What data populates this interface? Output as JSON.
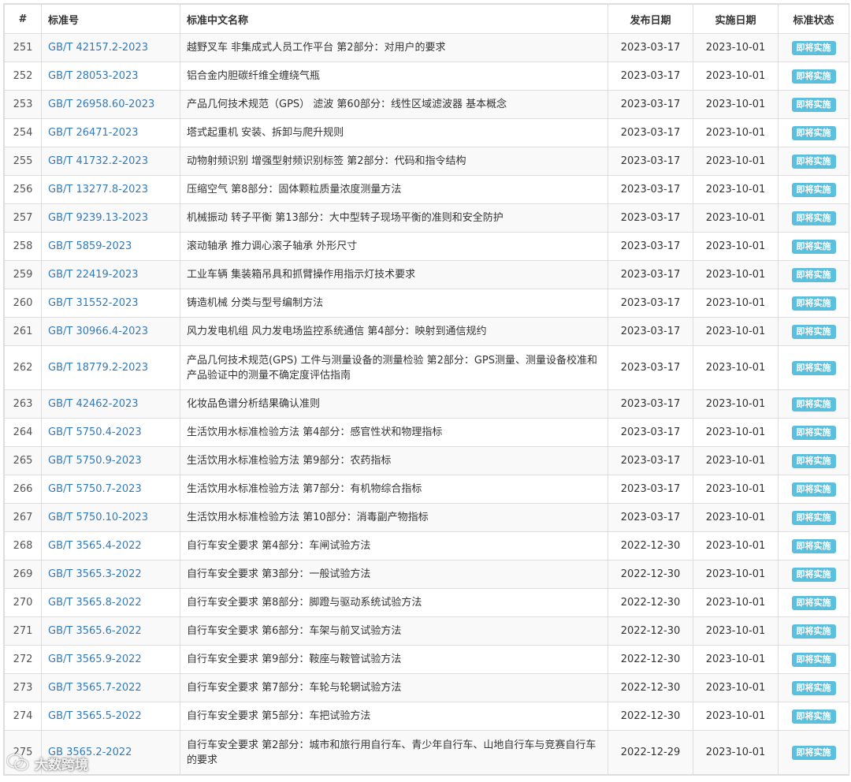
{
  "headers": {
    "num": "#",
    "code": "标准号",
    "name": "标准中文名称",
    "publish": "发布日期",
    "effective": "实施日期",
    "status": "标准状态"
  },
  "rows": [
    {
      "num": "251",
      "code": "GB/T 42157.2-2023",
      "name": "越野叉车 非集成式人员工作平台 第2部分：对用户的要求",
      "publish": "2023-03-17",
      "effective": "2023-10-01",
      "status": "即将实施"
    },
    {
      "num": "252",
      "code": "GB/T 28053-2023",
      "name": "铝合金内胆碳纤维全缠绕气瓶",
      "publish": "2023-03-17",
      "effective": "2023-10-01",
      "status": "即将实施"
    },
    {
      "num": "253",
      "code": "GB/T 26958.60-2023",
      "name": "产品几何技术规范（GPS） 滤波 第60部分：线性区域滤波器 基本概念",
      "publish": "2023-03-17",
      "effective": "2023-10-01",
      "status": "即将实施"
    },
    {
      "num": "254",
      "code": "GB/T 26471-2023",
      "name": "塔式起重机 安装、拆卸与爬升规则",
      "publish": "2023-03-17",
      "effective": "2023-10-01",
      "status": "即将实施"
    },
    {
      "num": "255",
      "code": "GB/T 41732.2-2023",
      "name": "动物射频识别 增强型射频识别标签 第2部分：代码和指令结构",
      "publish": "2023-03-17",
      "effective": "2023-10-01",
      "status": "即将实施"
    },
    {
      "num": "256",
      "code": "GB/T 13277.8-2023",
      "name": "压缩空气 第8部分：固体颗粒质量浓度测量方法",
      "publish": "2023-03-17",
      "effective": "2023-10-01",
      "status": "即将实施"
    },
    {
      "num": "257",
      "code": "GB/T 9239.13-2023",
      "name": "机械振动 转子平衡 第13部分：大中型转子现场平衡的准则和安全防护",
      "publish": "2023-03-17",
      "effective": "2023-10-01",
      "status": "即将实施"
    },
    {
      "num": "258",
      "code": "GB/T 5859-2023",
      "name": "滚动轴承 推力调心滚子轴承 外形尺寸",
      "publish": "2023-03-17",
      "effective": "2023-10-01",
      "status": "即将实施"
    },
    {
      "num": "259",
      "code": "GB/T 22419-2023",
      "name": "工业车辆 集装箱吊具和抓臂操作用指示灯技术要求",
      "publish": "2023-03-17",
      "effective": "2023-10-01",
      "status": "即将实施"
    },
    {
      "num": "260",
      "code": "GB/T 31552-2023",
      "name": "铸造机械 分类与型号编制方法",
      "publish": "2023-03-17",
      "effective": "2023-10-01",
      "status": "即将实施"
    },
    {
      "num": "261",
      "code": "GB/T 30966.4-2023",
      "name": "风力发电机组 风力发电场监控系统通信 第4部分：映射到通信规约",
      "publish": "2023-03-17",
      "effective": "2023-10-01",
      "status": "即将实施"
    },
    {
      "num": "262",
      "code": "GB/T 18779.2-2023",
      "name": "产品几何技术规范(GPS) 工件与测量设备的测量检验 第2部分：GPS测量、测量设备校准和产品验证中的测量不确定度评估指南",
      "publish": "2023-03-17",
      "effective": "2023-10-01",
      "status": "即将实施",
      "tall": true
    },
    {
      "num": "263",
      "code": "GB/T 42462-2023",
      "name": "化妆品色谱分析结果确认准则",
      "publish": "2023-03-17",
      "effective": "2023-10-01",
      "status": "即将实施"
    },
    {
      "num": "264",
      "code": "GB/T 5750.4-2023",
      "name": "生活饮用水标准检验方法 第4部分：感官性状和物理指标",
      "publish": "2023-03-17",
      "effective": "2023-10-01",
      "status": "即将实施"
    },
    {
      "num": "265",
      "code": "GB/T 5750.9-2023",
      "name": "生活饮用水标准检验方法 第9部分：农药指标",
      "publish": "2023-03-17",
      "effective": "2023-10-01",
      "status": "即将实施"
    },
    {
      "num": "266",
      "code": "GB/T 5750.7-2023",
      "name": "生活饮用水标准检验方法 第7部分：有机物综合指标",
      "publish": "2023-03-17",
      "effective": "2023-10-01",
      "status": "即将实施"
    },
    {
      "num": "267",
      "code": "GB/T 5750.10-2023",
      "name": "生活饮用水标准检验方法 第10部分：消毒副产物指标",
      "publish": "2023-03-17",
      "effective": "2023-10-01",
      "status": "即将实施"
    },
    {
      "num": "268",
      "code": "GB/T 3565.4-2022",
      "name": "自行车安全要求 第4部分：车闸试验方法",
      "publish": "2022-12-30",
      "effective": "2023-10-01",
      "status": "即将实施"
    },
    {
      "num": "269",
      "code": "GB/T 3565.3-2022",
      "name": "自行车安全要求 第3部分：一般试验方法",
      "publish": "2022-12-30",
      "effective": "2023-10-01",
      "status": "即将实施"
    },
    {
      "num": "270",
      "code": "GB/T 3565.8-2022",
      "name": "自行车安全要求 第8部分：脚蹬与驱动系统试验方法",
      "publish": "2022-12-30",
      "effective": "2023-10-01",
      "status": "即将实施"
    },
    {
      "num": "271",
      "code": "GB/T 3565.6-2022",
      "name": "自行车安全要求 第6部分：车架与前叉试验方法",
      "publish": "2022-12-30",
      "effective": "2023-10-01",
      "status": "即将实施"
    },
    {
      "num": "272",
      "code": "GB/T 3565.9-2022",
      "name": "自行车安全要求 第9部分：鞍座与鞍管试验方法",
      "publish": "2022-12-30",
      "effective": "2023-10-01",
      "status": "即将实施"
    },
    {
      "num": "273",
      "code": "GB/T 3565.7-2022",
      "name": "自行车安全要求 第7部分：车轮与轮辋试验方法",
      "publish": "2022-12-30",
      "effective": "2023-10-01",
      "status": "即将实施"
    },
    {
      "num": "274",
      "code": "GB/T 3565.5-2022",
      "name": "自行车安全要求 第5部分：车把试验方法",
      "publish": "2022-12-30",
      "effective": "2023-10-01",
      "status": "即将实施"
    },
    {
      "num": "275",
      "code": "GB 3565.2-2022",
      "name": "自行车安全要求 第2部分：城市和旅行用自行车、青少年自行车、山地自行车与竞赛自行车的要求",
      "publish": "2022-12-29",
      "effective": "2023-10-01",
      "status": "即将实施",
      "tall": true
    }
  ],
  "watermark": {
    "text": "大数跨境",
    "icon": "wechat-logo-icon"
  },
  "colors": {
    "link": "#337ab7",
    "badge": "#5bc0de",
    "stripe": "#f9f9f9",
    "border": "#dddddd"
  }
}
